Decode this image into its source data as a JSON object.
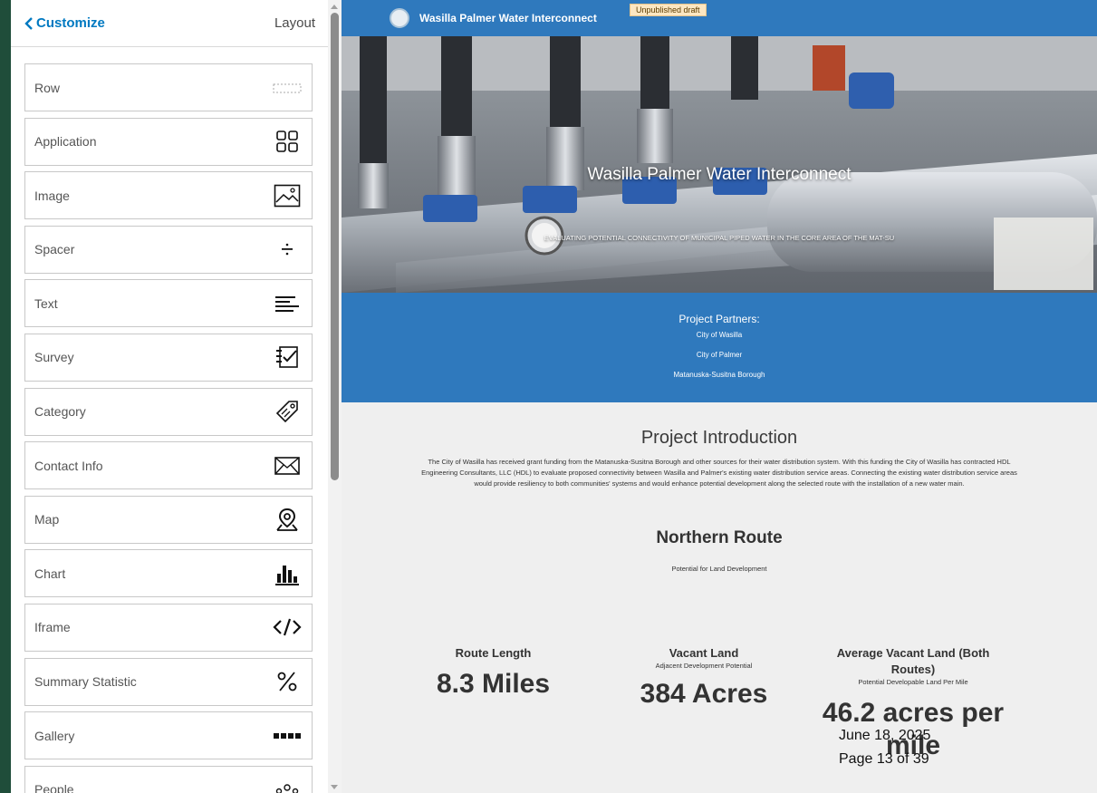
{
  "panel": {
    "back_label": "Customize",
    "layout_label": "Layout",
    "blocks": [
      {
        "label": "Row",
        "icon": "row-icon"
      },
      {
        "label": "Application",
        "icon": "application-grid-icon"
      },
      {
        "label": "Image",
        "icon": "image-icon"
      },
      {
        "label": "Spacer",
        "icon": "spacer-icon"
      },
      {
        "label": "Text",
        "icon": "text-icon"
      },
      {
        "label": "Survey",
        "icon": "survey-icon"
      },
      {
        "label": "Category",
        "icon": "category-tag-icon"
      },
      {
        "label": "Contact Info",
        "icon": "envelope-icon"
      },
      {
        "label": "Map",
        "icon": "map-pin-icon"
      },
      {
        "label": "Chart",
        "icon": "chart-icon"
      },
      {
        "label": "Iframe",
        "icon": "code-icon"
      },
      {
        "label": "Summary Statistic",
        "icon": "percent-icon"
      },
      {
        "label": "Gallery",
        "icon": "gallery-icon"
      },
      {
        "label": "People",
        "icon": "people-icon"
      }
    ]
  },
  "preview": {
    "site_name": "Wasilla Palmer Water Interconnect",
    "draft_badge": "Unpublished draft",
    "hero_title": "Wasilla Palmer Water Interconnect",
    "hero_subtitle": "EVALUATING POTENTIAL CONNECTIVITY OF MUNICIPAL PIPED WATER IN THE CORE AREA OF THE MAT-SU",
    "partners_title": "Project Partners:",
    "partners": [
      "City of Wasilla",
      "City of Palmer",
      "Matanuska-Susitna Borough"
    ],
    "intro_title": "Project Introduction",
    "intro_text": "The City of Wasilla has received grant funding from the Matanuska-Susitna Borough and other sources for their water distribution system. With this funding the City of Wasilla has contracted HDL Engineering Consultants, LLC (HDL) to evaluate proposed connectivity between Wasilla and Palmer's existing water distribution service areas. Connecting the existing water distribution service areas would provide resiliency to both communities' systems and would enhance potential development along the selected route with the installation of a new water main.",
    "route_title": "Northern Route",
    "route_subtitle": "Potential for Land Development",
    "stats": [
      {
        "label": "Route Length",
        "sublabel": "",
        "value": "8.3 Miles"
      },
      {
        "label": "Vacant Land",
        "sublabel": "Adjacent Development Potential",
        "value": "384 Acres"
      },
      {
        "label": "Average Vacant Land (Both Routes)",
        "sublabel": "Potential Developable Land Per Mile",
        "value": "46.2 acres per mile"
      }
    ]
  },
  "overlay": {
    "date": "June 18, 2025",
    "page": "Page 13 of 39"
  },
  "colors": {
    "accent": "#0079c1",
    "banner": "#2f79bd",
    "background": "#efefef"
  }
}
